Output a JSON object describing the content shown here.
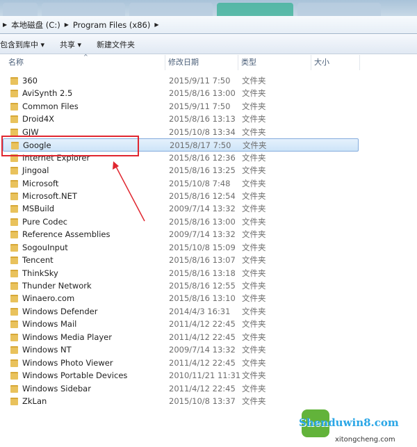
{
  "breadcrumb": [
    "本地磁盘 (C:)",
    "Program Files (x86)"
  ],
  "toolbar": {
    "include_library": "包含到库中 ▾",
    "share": "共享 ▾",
    "new_folder": "新建文件夹"
  },
  "columns": {
    "name": "名称",
    "date": "修改日期",
    "type": "类型",
    "size": "大小"
  },
  "files": [
    {
      "name": "360",
      "date": "2015/9/11 7:50",
      "type": "文件夹"
    },
    {
      "name": "AviSynth 2.5",
      "date": "2015/8/16 13:00",
      "type": "文件夹"
    },
    {
      "name": "Common Files",
      "date": "2015/9/11 7:50",
      "type": "文件夹"
    },
    {
      "name": "Droid4X",
      "date": "2015/8/16 13:13",
      "type": "文件夹"
    },
    {
      "name": "GJW",
      "date": "2015/10/8 13:34",
      "type": "文件夹"
    },
    {
      "name": "Google",
      "date": "2015/8/17 7:50",
      "type": "文件夹",
      "selected": true
    },
    {
      "name": "Internet Explorer",
      "date": "2015/8/16 12:36",
      "type": "文件夹"
    },
    {
      "name": "Jingoal",
      "date": "2015/8/16 13:25",
      "type": "文件夹"
    },
    {
      "name": "Microsoft",
      "date": "2015/10/8 7:48",
      "type": "文件夹"
    },
    {
      "name": "Microsoft.NET",
      "date": "2015/8/16 12:54",
      "type": "文件夹"
    },
    {
      "name": "MSBuild",
      "date": "2009/7/14 13:32",
      "type": "文件夹"
    },
    {
      "name": "Pure Codec",
      "date": "2015/8/16 13:00",
      "type": "文件夹"
    },
    {
      "name": "Reference Assemblies",
      "date": "2009/7/14 13:32",
      "type": "文件夹"
    },
    {
      "name": "SogouInput",
      "date": "2015/10/8 15:09",
      "type": "文件夹"
    },
    {
      "name": "Tencent",
      "date": "2015/8/16 13:07",
      "type": "文件夹"
    },
    {
      "name": "ThinkSky",
      "date": "2015/8/16 13:18",
      "type": "文件夹"
    },
    {
      "name": "Thunder Network",
      "date": "2015/8/16 12:55",
      "type": "文件夹"
    },
    {
      "name": "Winaero.com",
      "date": "2015/8/16 13:10",
      "type": "文件夹"
    },
    {
      "name": "Windows Defender",
      "date": "2014/4/3 16:31",
      "type": "文件夹"
    },
    {
      "name": "Windows Mail",
      "date": "2011/4/12 22:45",
      "type": "文件夹"
    },
    {
      "name": "Windows Media Player",
      "date": "2011/4/12 22:45",
      "type": "文件夹"
    },
    {
      "name": "Windows NT",
      "date": "2009/7/14 13:32",
      "type": "文件夹"
    },
    {
      "name": "Windows Photo Viewer",
      "date": "2011/4/12 22:45",
      "type": "文件夹"
    },
    {
      "name": "Windows Portable Devices",
      "date": "2010/11/21 11:31",
      "type": "文件夹"
    },
    {
      "name": "Windows Sidebar",
      "date": "2011/4/12 22:45",
      "type": "文件夹"
    },
    {
      "name": "ZkLan",
      "date": "2015/10/8 13:37",
      "type": "文件夹"
    }
  ],
  "watermark": {
    "brand": "Shenduwin8.com",
    "sub": "xitongcheng.com",
    "logo_text": "系统城"
  },
  "colors": {
    "highlight": "#e0262f",
    "selection": "#cde4f8"
  }
}
